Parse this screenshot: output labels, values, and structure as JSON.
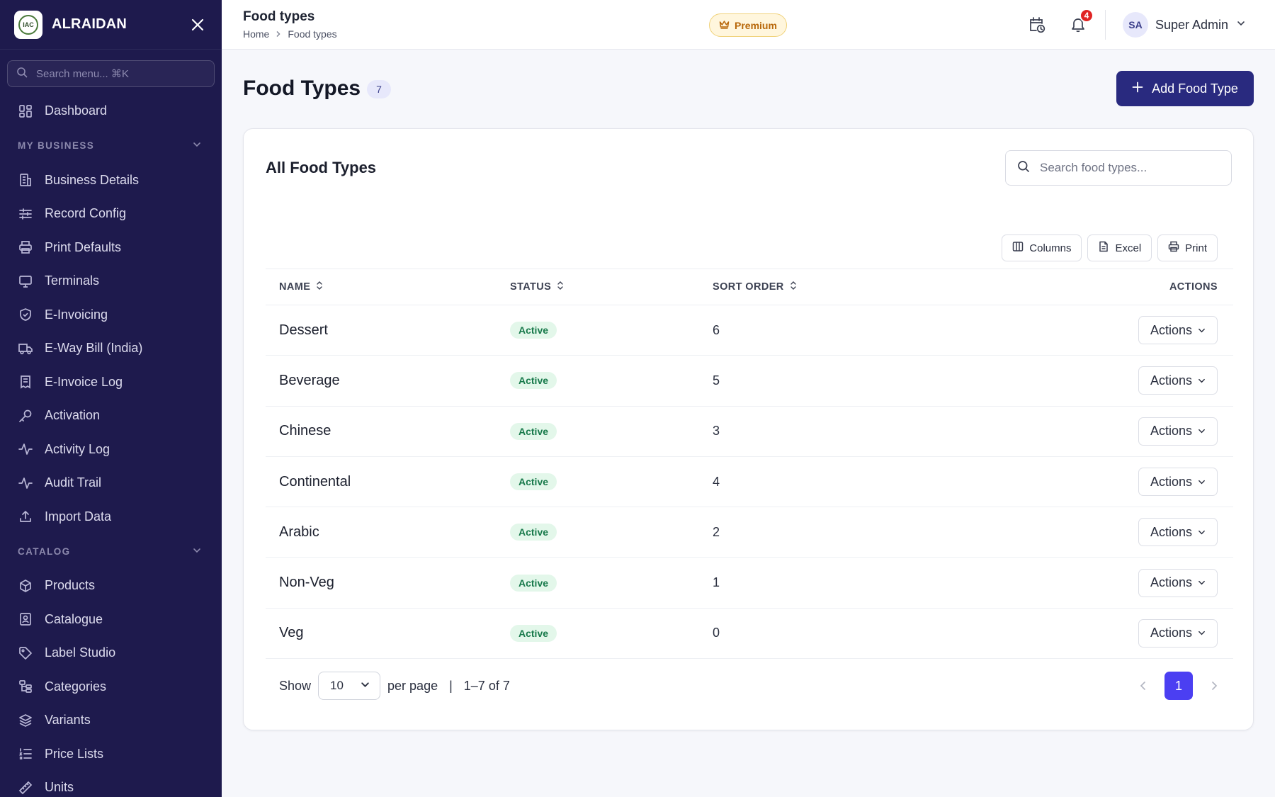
{
  "sidebar": {
    "brand": "ALRAIDAN",
    "logo_text": "IAC",
    "search_placeholder": "Search menu... ⌘K",
    "top_items": [
      {
        "label": "Dashboard",
        "icon": "dashboard-icon"
      }
    ],
    "sections": [
      {
        "title": "MY BUSINESS",
        "items": [
          {
            "label": "Business Details",
            "icon": "building-icon"
          },
          {
            "label": "Record Config",
            "icon": "sliders-icon"
          },
          {
            "label": "Print Defaults",
            "icon": "printer-icon"
          },
          {
            "label": "Terminals",
            "icon": "monitor-icon"
          },
          {
            "label": "E-Invoicing",
            "icon": "shield-icon"
          },
          {
            "label": "E-Way Bill (India)",
            "icon": "truck-icon"
          },
          {
            "label": "E-Invoice Log",
            "icon": "receipt-icon"
          },
          {
            "label": "Activation",
            "icon": "key-icon"
          },
          {
            "label": "Activity Log",
            "icon": "activity-icon"
          },
          {
            "label": "Audit Trail",
            "icon": "activity-icon"
          },
          {
            "label": "Import Data",
            "icon": "upload-icon"
          }
        ]
      },
      {
        "title": "CATALOG",
        "items": [
          {
            "label": "Products",
            "icon": "box-icon"
          },
          {
            "label": "Catalogue",
            "icon": "image-icon"
          },
          {
            "label": "Label Studio",
            "icon": "tag-icon"
          },
          {
            "label": "Categories",
            "icon": "tree-icon"
          },
          {
            "label": "Variants",
            "icon": "layers-icon"
          },
          {
            "label": "Price Lists",
            "icon": "list-ordered-icon"
          },
          {
            "label": "Units",
            "icon": "ruler-icon"
          }
        ]
      }
    ]
  },
  "header": {
    "title": "Food types",
    "breadcrumb": [
      "Home",
      "Food types"
    ],
    "premium_label": "Premium",
    "notification_count": "4",
    "user_initials": "SA",
    "user_name": "Super Admin"
  },
  "main": {
    "page_title": "Food Types",
    "count": "7",
    "add_button": "Add Food Type",
    "card_title": "All Food Types",
    "search_placeholder": "Search food types...",
    "tools": [
      "Columns",
      "Excel",
      "Print"
    ],
    "columns": {
      "name": "NAME",
      "status": "STATUS",
      "sort_order": "SORT ORDER",
      "actions": "ACTIONS"
    },
    "rows": [
      {
        "name": "Dessert",
        "status": "Active",
        "sort_order": "6",
        "action": "Actions"
      },
      {
        "name": "Beverage",
        "status": "Active",
        "sort_order": "5",
        "action": "Actions"
      },
      {
        "name": "Chinese",
        "status": "Active",
        "sort_order": "3",
        "action": "Actions"
      },
      {
        "name": "Continental",
        "status": "Active",
        "sort_order": "4",
        "action": "Actions"
      },
      {
        "name": "Arabic",
        "status": "Active",
        "sort_order": "2",
        "action": "Actions"
      },
      {
        "name": "Non-Veg",
        "status": "Active",
        "sort_order": "1",
        "action": "Actions"
      },
      {
        "name": "Veg",
        "status": "Active",
        "sort_order": "0",
        "action": "Actions"
      }
    ],
    "footer": {
      "show_label": "Show",
      "per_page_value": "10",
      "per_page_label": "per page",
      "separator": "|",
      "range": "1–7 of 7",
      "current_page": "1"
    }
  },
  "colors": {
    "sidebar_bg": "#1e1a4d",
    "primary_button": "#292a7f",
    "page_active": "#4b3ff2",
    "status_active_bg": "#e3f7ea",
    "status_active_text": "#17794a",
    "premium_text": "#b8680b",
    "badge_red": "#e02424"
  }
}
